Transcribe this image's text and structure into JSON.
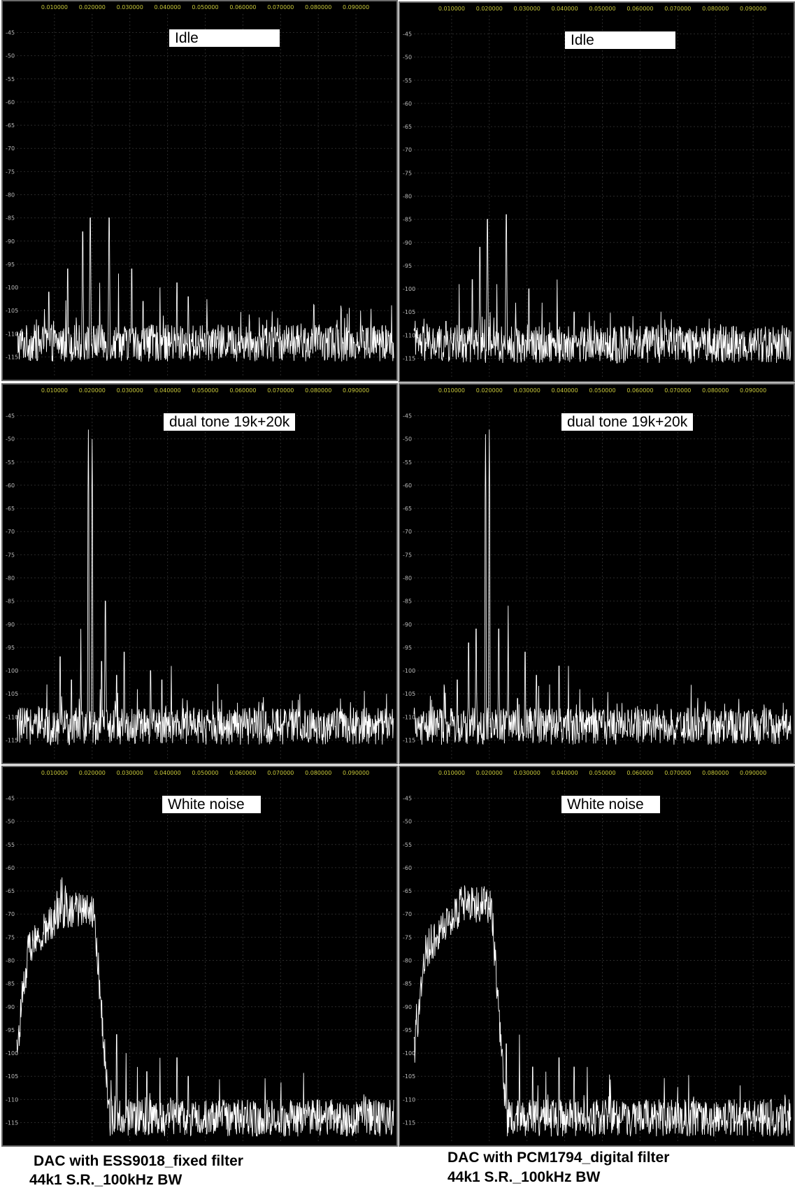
{
  "colors": {
    "panel_bg": "#000000",
    "grid": "#2a2a2a",
    "trace": "#ffffff",
    "x_ticks": "#c8c83a",
    "y_ticks": "#bdbdbd"
  },
  "axis": {
    "x_ticks": [
      "0.010000",
      "0.020000",
      "0.030000",
      "0.040000",
      "0.050000",
      "0.060000",
      "0.070000",
      "0.080000",
      "0.090000"
    ],
    "y_ticks": [
      "-45",
      "-50",
      "-55",
      "-60",
      "-65",
      "-70",
      "-75",
      "-80",
      "-85",
      "-90",
      "-95",
      "-100",
      "-105",
      "-110",
      "-115"
    ]
  },
  "panels": [
    {
      "label": "Idle"
    },
    {
      "label": "Idle"
    },
    {
      "label": "dual tone 19k+20k"
    },
    {
      "label": "dual tone 19k+20k"
    },
    {
      "label": "White noise"
    },
    {
      "label": "White noise"
    }
  ],
  "captions": {
    "left": {
      "line1": "DAC with ESS9018_fixed filter",
      "line2": "44k1 S.R._100kHz BW"
    },
    "right": {
      "line1": "DAC with PCM1794_digital filter",
      "line2": "44k1 S.R._100kHz BW"
    }
  },
  "chart_data": [
    {
      "type": "line",
      "title": "Idle",
      "xlim": [
        0,
        0.1
      ],
      "ylim": [
        -119,
        -41
      ],
      "noise_floor": -112,
      "series": [
        {
          "peaks": [
            [
              0.0085,
              -101
            ],
            [
              0.0135,
              -96
            ],
            [
              0.0175,
              -88
            ],
            [
              0.0195,
              -85
            ],
            [
              0.022,
              -99
            ],
            [
              0.0245,
              -85
            ],
            [
              0.027,
              -97
            ],
            [
              0.0305,
              -96
            ],
            [
              0.0335,
              -103
            ],
            [
              0.038,
              -100
            ],
            [
              0.0425,
              -99
            ],
            [
              0.0455,
              -102
            ]
          ]
        }
      ]
    },
    {
      "type": "line",
      "title": "Idle",
      "xlim": [
        0,
        0.1
      ],
      "ylim": [
        -119,
        -41
      ],
      "noise_floor": -112,
      "series": [
        {
          "peaks": [
            [
              0.0085,
              -107
            ],
            [
              0.012,
              -99
            ],
            [
              0.0155,
              -98
            ],
            [
              0.0175,
              -91
            ],
            [
              0.0195,
              -85
            ],
            [
              0.022,
              -99
            ],
            [
              0.0245,
              -84
            ],
            [
              0.027,
              -103
            ],
            [
              0.0305,
              -100
            ],
            [
              0.034,
              -103
            ],
            [
              0.038,
              -98
            ],
            [
              0.0425,
              -105
            ],
            [
              0.047,
              -108
            ],
            [
              0.06,
              -108
            ],
            [
              0.075,
              -108
            ],
            [
              0.092,
              -109
            ],
            [
              0.0985,
              -110
            ]
          ]
        }
      ]
    },
    {
      "type": "line",
      "title": "dual tone 19k+20k",
      "xlim": [
        0,
        0.1
      ],
      "ylim": [
        -119,
        -41
      ],
      "noise_floor": -112,
      "series": [
        {
          "peaks": [
            [
              0.008,
              -103
            ],
            [
              0.0115,
              -97
            ],
            [
              0.0145,
              -102
            ],
            [
              0.017,
              -91
            ],
            [
              0.019,
              -48
            ],
            [
              0.02,
              -50
            ],
            [
              0.0225,
              -98
            ],
            [
              0.0235,
              -85
            ],
            [
              0.0265,
              -101
            ],
            [
              0.0285,
              -96
            ],
            [
              0.032,
              -104
            ],
            [
              0.0355,
              -100
            ],
            [
              0.0385,
              -102
            ],
            [
              0.041,
              -99
            ],
            [
              0.044,
              -106
            ],
            [
              0.047,
              -108
            ]
          ]
        }
      ]
    },
    {
      "type": "line",
      "title": "dual tone 19k+20k",
      "xlim": [
        0,
        0.1
      ],
      "ylim": [
        -119,
        -41
      ],
      "noise_floor": -112,
      "series": [
        {
          "peaks": [
            [
              0.008,
              -103
            ],
            [
              0.0115,
              -102
            ],
            [
              0.0145,
              -94
            ],
            [
              0.0165,
              -91
            ],
            [
              0.019,
              -49
            ],
            [
              0.02,
              -48
            ],
            [
              0.0225,
              -91
            ],
            [
              0.025,
              -86
            ],
            [
              0.0275,
              -106
            ],
            [
              0.0295,
              -96
            ],
            [
              0.0325,
              -101
            ],
            [
              0.036,
              -103
            ],
            [
              0.0385,
              -99
            ],
            [
              0.041,
              -99
            ],
            [
              0.044,
              -104
            ],
            [
              0.048,
              -110
            ],
            [
              0.07,
              -109
            ],
            [
              0.098,
              -110
            ]
          ]
        }
      ]
    },
    {
      "type": "line",
      "title": "White noise",
      "xlim": [
        0,
        0.1
      ],
      "ylim": [
        -119,
        -41
      ],
      "noise_floor": -114,
      "series": [
        {
          "band": {
            "edge": 0.0205,
            "level": -69
          },
          "peaks": [
            [
              0.0265,
              -96
            ],
            [
              0.029,
              -100
            ],
            [
              0.032,
              -103
            ],
            [
              0.0345,
              -104
            ],
            [
              0.038,
              -101
            ],
            [
              0.0425,
              -101
            ],
            [
              0.0455,
              -105
            ]
          ]
        }
      ]
    },
    {
      "type": "line",
      "title": "White noise",
      "xlim": [
        0,
        0.1
      ],
      "ylim": [
        -119,
        -41
      ],
      "noise_floor": -114,
      "series": [
        {
          "band": {
            "edge": 0.0205,
            "level": -68
          },
          "peaks": [
            [
              0.0245,
              -98
            ],
            [
              0.028,
              -96
            ],
            [
              0.0315,
              -103
            ],
            [
              0.035,
              -104
            ],
            [
              0.0385,
              -101
            ],
            [
              0.0425,
              -103
            ],
            [
              0.046,
              -103
            ],
            [
              0.065,
              -110
            ],
            [
              0.085,
              -110
            ]
          ]
        }
      ]
    }
  ]
}
